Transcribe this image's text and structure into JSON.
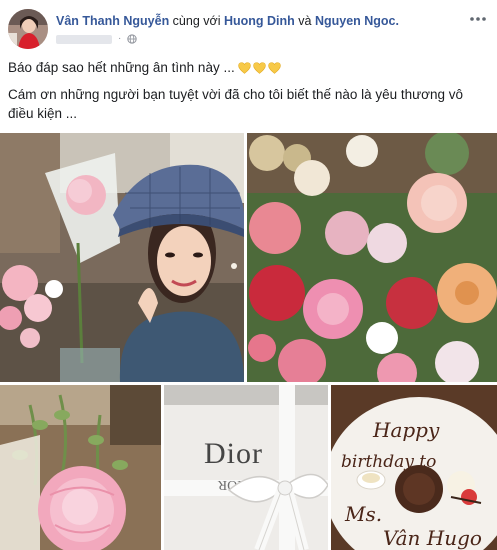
{
  "post": {
    "author": "Vân Thanh Nguyễn",
    "with_text": " cùng với ",
    "friend_1": "Huong Dinh",
    "and_text": " và ",
    "friend_2": "Nguyen Ngoc.",
    "privacy_icon": "globe-icon",
    "more_icon": "ellipsis-icon",
    "text_line_1": "Báo đáp sao hết những ân tình này ...",
    "text_line_2": "Cám ơn những người bạn tuyệt vời đã cho tôi biết thế nào là yêu thương vô điều kiện ...",
    "emoji": [
      "yellow-heart",
      "yellow-heart",
      "yellow-heart"
    ],
    "heart_color": "#f7c948",
    "link_color": "#365899"
  },
  "photos": [
    {
      "name": "selfie-with-flowers"
    },
    {
      "name": "flower-bouquet-closeup"
    },
    {
      "name": "pink-peony"
    },
    {
      "name": "dior-gift-box",
      "brand_text": "Dior",
      "reversed_text": "DIOR"
    },
    {
      "name": "birthday-dessert-plate",
      "plate_text_1": "Happy",
      "plate_text_2": "birthday to",
      "plate_text_3": "Ms.",
      "plate_text_4": "Vân Hugo"
    }
  ]
}
